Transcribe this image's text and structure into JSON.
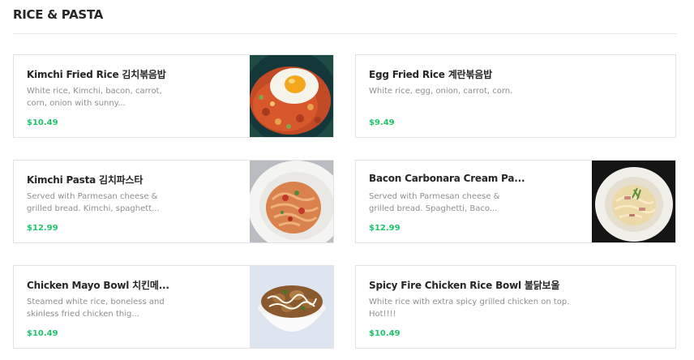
{
  "section": {
    "title": "RICE & PASTA"
  },
  "menu_items": [
    {
      "name": "Kimchi Fried Rice 김치볶음밥",
      "description": "White rice, Kimchi, bacon, carrot, corn, onion with sunny...",
      "price": "$10.49",
      "image": "kimchi-fried-rice-photo"
    },
    {
      "name": "Egg Fried Rice 계란볶음밥",
      "description": "White rice, egg, onion, carrot, corn.",
      "price": "$9.49",
      "image": null
    },
    {
      "name": "Kimchi Pasta 김치파스타",
      "description": "Served with Parmesan cheese & grilled bread. Kimchi, spaghett...",
      "price": "$12.99",
      "image": "kimchi-pasta-photo"
    },
    {
      "name": "Bacon Carbonara Cream Pa...",
      "description": "Served with Parmesan cheese & grilled bread. Spaghetti, Baco...",
      "price": "$12.99",
      "image": "carbonara-photo"
    },
    {
      "name": "Chicken Mayo Bowl 치킨메...",
      "description": "Steamed white rice, boneless and skinless fried chicken thig...",
      "price": "$10.49",
      "image": "chicken-mayo-bowl-photo"
    },
    {
      "name": "Spicy Fire Chicken Rice Bowl 불닭보울",
      "description": "White rice with extra spicy grilled chicken on top. Hot!!!!",
      "price": "$10.49",
      "image": null
    }
  ],
  "colors": {
    "price": "#21c46b",
    "title": "#262626",
    "description": "#8f8f8f",
    "border": "#e3e3e3"
  }
}
